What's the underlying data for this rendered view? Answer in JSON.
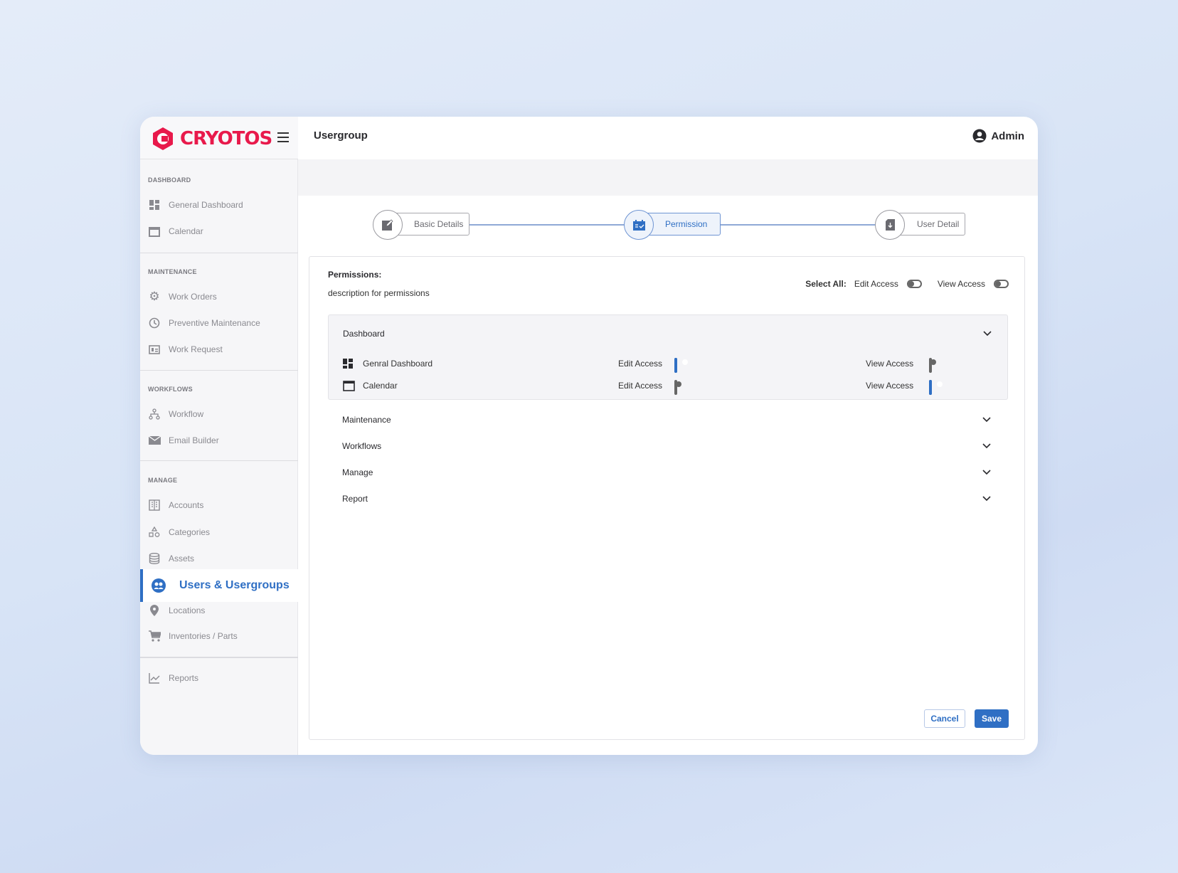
{
  "brand": {
    "name": "CRYOTOS",
    "color": "#e8194b"
  },
  "header": {
    "title": "Usergroup",
    "user": "Admin"
  },
  "sidebar": {
    "sections": [
      {
        "label": "DASHBOARD",
        "items": [
          "General Dashboard",
          "Calendar"
        ]
      },
      {
        "label": "MAINTENANCE",
        "items": [
          "Work Orders",
          "Preventive Maintenance",
          "Work Request"
        ]
      },
      {
        "label": "WORKFLOWS",
        "items": [
          "Workflow",
          "Email Builder"
        ]
      },
      {
        "label": "MANAGE",
        "items": [
          "Accounts",
          "Categories",
          "Assets",
          "Users & Usergroups",
          "Locations",
          "Inventories / Parts"
        ]
      }
    ],
    "reports": "Reports",
    "active": "Users & Usergroups"
  },
  "stepper": {
    "steps": [
      {
        "label": "Basic Details",
        "state": "done"
      },
      {
        "label": "Permission",
        "state": "active"
      },
      {
        "label": "User Detail",
        "state": "pending"
      }
    ]
  },
  "permissions": {
    "title": "Permissions:",
    "description": "description for permissions",
    "select_all": {
      "label": "Select All:",
      "edit_label": "Edit Access",
      "view_label": "View Access",
      "edit": false,
      "view": false
    },
    "groups": [
      {
        "name": "Dashboard",
        "expanded": true,
        "rows": [
          {
            "name": "Genral Dashboard",
            "edit_label": "Edit Access",
            "view_label": "View Access",
            "edit": true,
            "view": false
          },
          {
            "name": "Calendar",
            "edit_label": "Edit Access",
            "view_label": "View Access",
            "edit": false,
            "view": true
          }
        ]
      },
      {
        "name": "Maintenance",
        "expanded": false
      },
      {
        "name": "Workflows",
        "expanded": false
      },
      {
        "name": "Manage",
        "expanded": false
      },
      {
        "name": "Report",
        "expanded": false
      }
    ]
  },
  "actions": {
    "cancel": "Cancel",
    "save": "Save"
  },
  "colors": {
    "accent": "#2f6fc4",
    "brand": "#e8194b"
  }
}
